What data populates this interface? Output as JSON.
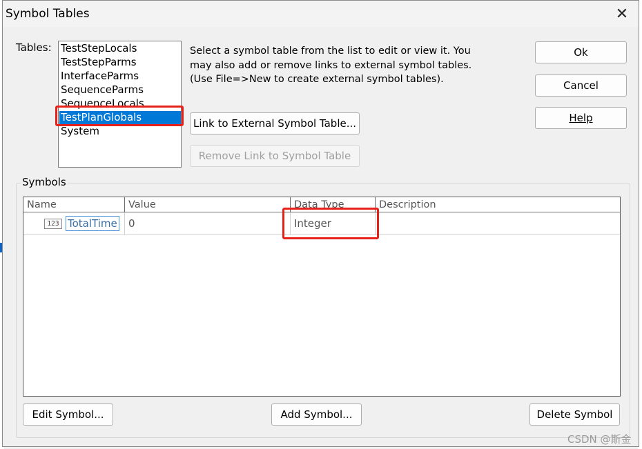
{
  "window": {
    "title": "Symbol Tables"
  },
  "tables": {
    "label": "Tables:",
    "items": [
      "TestStepLocals",
      "TestStepParms",
      "InterfaceParms",
      "SequenceParms",
      "SequenceLocals",
      "TestPlanGlobals",
      "System"
    ],
    "selected": "TestPlanGlobals"
  },
  "description": "Select a symbol table from the list to edit or view it. You may also add or remove links to external symbol tables. (Use File=>New to create external symbol tables).",
  "buttons": {
    "ok": "Ok",
    "cancel": "Cancel",
    "help": "Help",
    "link_external": "Link to External Symbol Table...",
    "remove_link": "Remove Link to Symbol Table",
    "edit_symbol": "Edit Symbol...",
    "add_symbol": "Add Symbol...",
    "delete_symbol": "Delete Symbol"
  },
  "symbols": {
    "group_label": "Symbols",
    "columns": [
      "Name",
      "Value",
      "Data Type",
      "Description"
    ],
    "rows": [
      {
        "icon": "123",
        "name": "TotalTime",
        "value": "0",
        "data_type": "Integer",
        "description": ""
      }
    ]
  },
  "watermark": "CSDN @斯金",
  "colors": {
    "selection": "#0078d7",
    "highlight": "#e8201a"
  }
}
